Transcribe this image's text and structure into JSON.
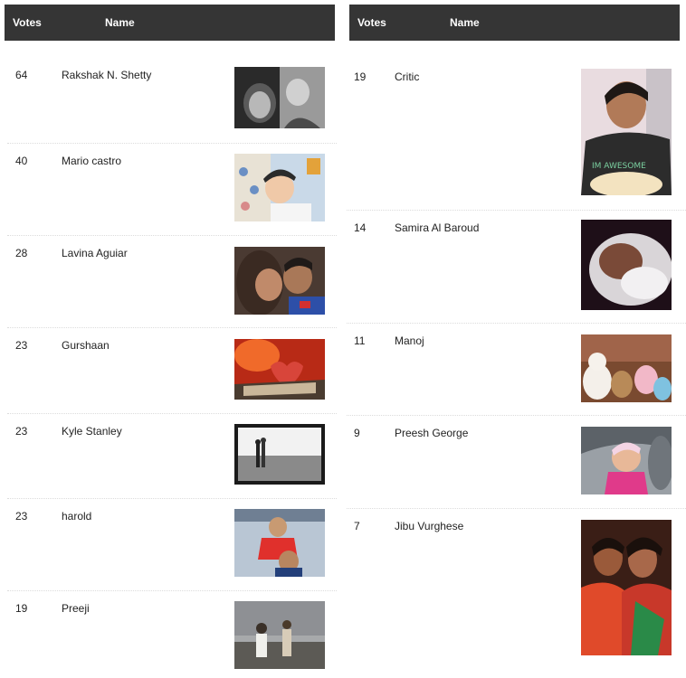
{
  "left_table": {
    "header": {
      "votes": "Votes",
      "name": "Name"
    },
    "rows": [
      {
        "votes": "64",
        "name": "Rakshak N. Shetty",
        "photo": "couple-photo"
      },
      {
        "votes": "40",
        "name": "Mario castro",
        "photo": "baby-photo"
      },
      {
        "votes": "28",
        "name": "Lavina Aguiar",
        "photo": "kiss-photo"
      },
      {
        "votes": "23",
        "name": "Gurshaan",
        "photo": "heart-book-photo"
      },
      {
        "votes": "23",
        "name": "Kyle Stanley",
        "photo": "beach-couple-photo"
      },
      {
        "votes": "23",
        "name": "harold",
        "photo": "boys-photo"
      },
      {
        "votes": "19",
        "name": "Preeji",
        "photo": "kids-beach-photo"
      }
    ]
  },
  "right_table": {
    "header": {
      "votes": "Votes",
      "name": "Name"
    },
    "rows": [
      {
        "votes": "19",
        "name": "Critic",
        "photo": "father-baby-photo"
      },
      {
        "votes": "14",
        "name": "Samira Al Baroud",
        "photo": "newborn-photo"
      },
      {
        "votes": "11",
        "name": "Manoj",
        "photo": "teddy-bears-photo"
      },
      {
        "votes": "9",
        "name": "Preesh George",
        "photo": "baby-car-photo"
      },
      {
        "votes": "7",
        "name": "Jibu Vurghese",
        "photo": "mother-child-photo"
      }
    ]
  }
}
